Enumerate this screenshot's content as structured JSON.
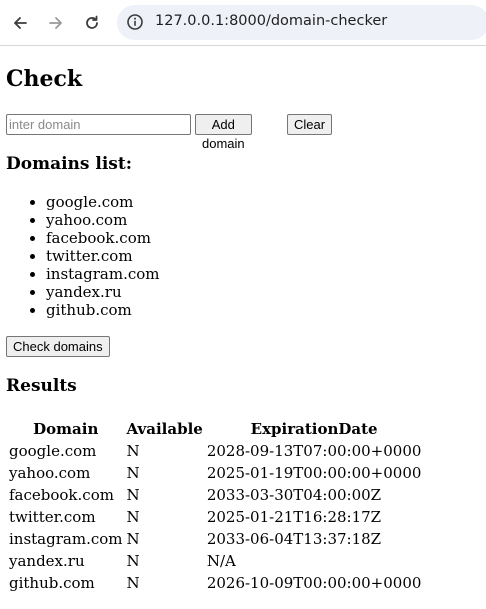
{
  "browser": {
    "url": "127.0.0.1:8000/domain-checker",
    "back_icon": "arrow-left-icon",
    "forward_icon": "arrow-right-icon",
    "reload_icon": "reload-icon",
    "info_icon": "info-icon"
  },
  "page": {
    "title": "Check",
    "input_placeholder": "inter domain",
    "add_button": "Add domain",
    "clear_button": "Clear",
    "domains_heading": "Domains list:",
    "domains": [
      "google.com",
      "yahoo.com",
      "facebook.com",
      "twitter.com",
      "instagram.com",
      "yandex.ru",
      "github.com"
    ],
    "check_button": "Check domains",
    "results_heading": "Results",
    "results_columns": [
      "Domain",
      "Available",
      "ExpirationDate"
    ],
    "results_rows": [
      [
        "google.com",
        "N",
        "2028-09-13T07:00:00+0000"
      ],
      [
        "yahoo.com",
        "N",
        "2025-01-19T00:00:00+0000"
      ],
      [
        "facebook.com",
        "N",
        "2033-03-30T04:00:00Z"
      ],
      [
        "twitter.com",
        "N",
        "2025-01-21T16:28:17Z"
      ],
      [
        "instagram.com",
        "N",
        "2033-06-04T13:37:18Z"
      ],
      [
        "yandex.ru",
        "N",
        "N/A"
      ],
      [
        "github.com",
        "N",
        "2026-10-09T00:00:00+0000"
      ]
    ]
  }
}
